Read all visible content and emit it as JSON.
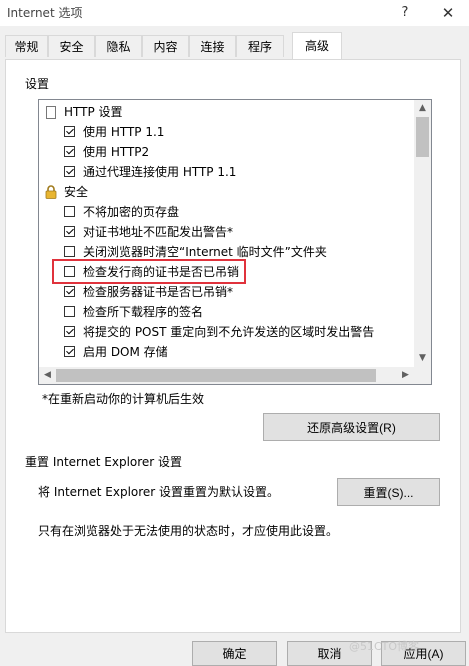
{
  "window": {
    "title": "Internet 选项",
    "help_icon": "?",
    "close_icon": "✕"
  },
  "tabs": [
    {
      "label": "常规"
    },
    {
      "label": "安全"
    },
    {
      "label": "隐私"
    },
    {
      "label": "内容"
    },
    {
      "label": "连接"
    },
    {
      "label": "程序"
    },
    {
      "label": "高级"
    }
  ],
  "active_tab": "高级",
  "settings": {
    "group_label": "设置",
    "items": [
      {
        "type": "category",
        "icon": "page-icon",
        "label": "HTTP 设置"
      },
      {
        "type": "checkbox",
        "checked": true,
        "label": "使用 HTTP 1.1"
      },
      {
        "type": "checkbox",
        "checked": true,
        "label": "使用 HTTP2"
      },
      {
        "type": "checkbox",
        "checked": true,
        "label": "通过代理连接使用 HTTP 1.1"
      },
      {
        "type": "category",
        "icon": "lock-icon",
        "label": "安全"
      },
      {
        "type": "checkbox",
        "checked": false,
        "label": "不将加密的页存盘"
      },
      {
        "type": "checkbox",
        "checked": true,
        "label": "对证书地址不匹配发出警告*"
      },
      {
        "type": "checkbox",
        "checked": false,
        "label": "关闭浏览器时清空“Internet 临时文件”文件夹"
      },
      {
        "type": "checkbox",
        "checked": false,
        "label": "检查发行商的证书是否已吊销"
      },
      {
        "type": "checkbox",
        "checked": true,
        "label": "检查服务器证书是否已吊销*"
      },
      {
        "type": "checkbox",
        "checked": false,
        "label": "检查所下载程序的签名"
      },
      {
        "type": "checkbox",
        "checked": true,
        "label": "将提交的 POST 重定向到不允许发送的区域时发出警告"
      },
      {
        "type": "checkbox",
        "checked": true,
        "label": "启用 DOM 存储"
      }
    ],
    "restart_note": "*在重新启动你的计算机后生效",
    "restore_button": "还原高级设置(R)"
  },
  "reset": {
    "group_label": "重置 Internet Explorer 设置",
    "description": "将 Internet Explorer 设置重置为默认设置。",
    "reset_button": "重置(S)...",
    "note": "只有在浏览器处于无法使用的状态时，才应使用此设置。"
  },
  "footer": {
    "ok": "确定",
    "cancel": "取消",
    "apply": "应用(A)"
  },
  "watermark": "@51CTO博客"
}
